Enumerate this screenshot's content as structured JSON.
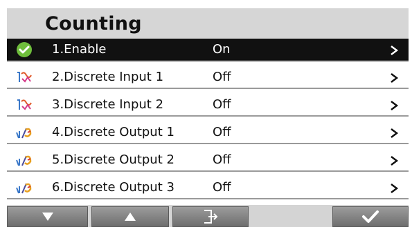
{
  "header": {
    "title": "Counting"
  },
  "menu": {
    "items": [
      {
        "label": "1.Enable",
        "value": "On",
        "icon": "check-circle-icon",
        "selected": true
      },
      {
        "label": "2.Discrete Input 1",
        "value": "Off",
        "icon": "discrete-input-icon",
        "selected": false
      },
      {
        "label": "3.Discrete Input 2",
        "value": "Off",
        "icon": "discrete-input-icon",
        "selected": false
      },
      {
        "label": "4.Discrete Output 1",
        "value": "Off",
        "icon": "discrete-output-icon",
        "selected": false
      },
      {
        "label": "5.Discrete Output 2",
        "value": "Off",
        "icon": "discrete-output-icon",
        "selected": false
      },
      {
        "label": "6.Discrete Output 3",
        "value": "Off",
        "icon": "discrete-output-icon",
        "selected": false
      }
    ]
  },
  "footer": {
    "buttons": [
      "arrow-down-icon",
      "arrow-up-icon",
      "exit-icon",
      "checkmark-icon"
    ]
  },
  "colors": {
    "header_bg": "#d6d6d6",
    "selected_bg": "#111111",
    "check_green": "#6fbe3c",
    "button_bg": "#808080"
  }
}
